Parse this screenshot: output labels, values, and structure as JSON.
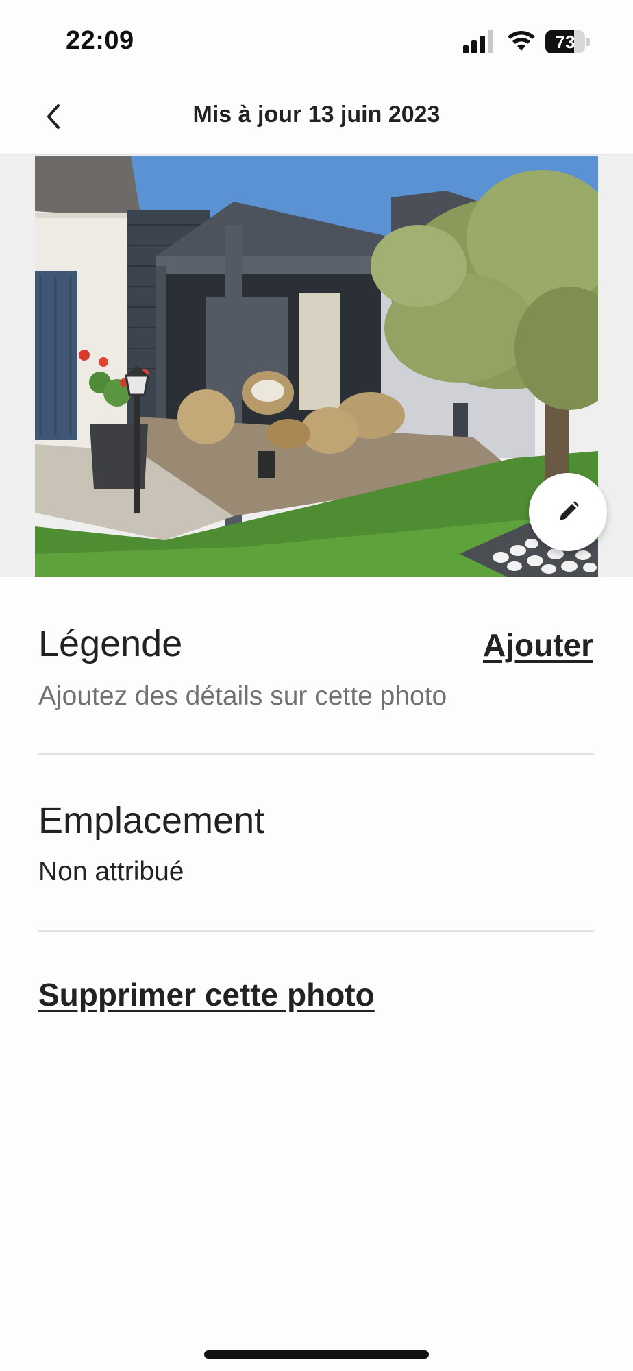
{
  "status_bar": {
    "time": "22:09",
    "battery_level": "73",
    "battery_fraction": 0.73
  },
  "header": {
    "title": "Mis à jour 13 juin 2023",
    "back_icon": "chevron-left-icon"
  },
  "photo": {
    "description_icon": "photo",
    "edit_icon": "pencil-icon"
  },
  "caption": {
    "title": "Légende",
    "action": "Ajouter",
    "placeholder": "Ajoutez des détails sur cette photo"
  },
  "location": {
    "title": "Emplacement",
    "value": "Non attribué"
  },
  "delete": {
    "label": "Supprimer cette photo"
  },
  "colors": {
    "text_primary": "#222222",
    "text_secondary": "#717171",
    "divider": "#e2e2e2"
  }
}
